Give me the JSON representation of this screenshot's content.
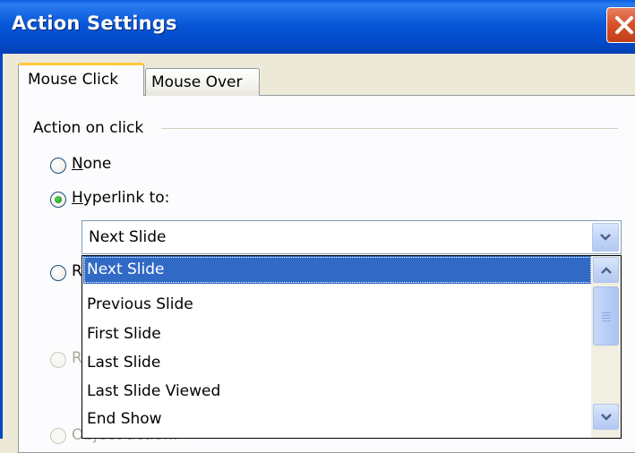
{
  "window": {
    "title": "Action Settings",
    "close_icon": "close-icon"
  },
  "tabs": [
    {
      "label": "Mouse Click",
      "active": true
    },
    {
      "label": "Mouse Over",
      "active": false
    }
  ],
  "action_group": {
    "label": "Action on click",
    "options": [
      {
        "label": "None",
        "access_key": "N",
        "rest": "one",
        "selected": false,
        "enabled": true
      },
      {
        "label": "Hyperlink to:",
        "access_key": "H",
        "rest": "yperlink to:",
        "selected": true,
        "enabled": true
      }
    ],
    "partially_visible": [
      {
        "fragment": "R",
        "enabled": true
      },
      {
        "fragment": "R",
        "enabled": false
      },
      {
        "fragment": "Object action:",
        "enabled": false
      }
    ]
  },
  "hyperlink_combo": {
    "value": "Next Slide",
    "dropdown_icon": "chevron-down-icon"
  },
  "hyperlink_list": {
    "items": [
      "Next Slide",
      "Previous Slide",
      "First Slide",
      "Last Slide",
      "Last Slide Viewed",
      "End Show"
    ],
    "selected_index": 0,
    "scroll_up_icon": "chevron-up-icon",
    "scroll_down_icon": "chevron-down-icon"
  },
  "colors": {
    "titlebar": "#0757d8",
    "selection": "#316ac5",
    "active_tab_accent": "#ffc83c",
    "radio_dot": "#21a121",
    "close_button": "#d8532c"
  }
}
